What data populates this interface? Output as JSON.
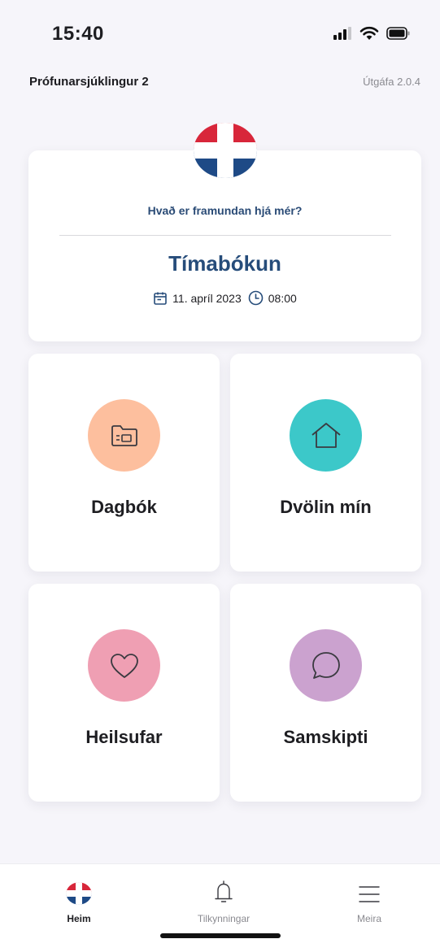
{
  "status_bar": {
    "time": "15:40"
  },
  "header": {
    "patient_name": "Prófunarsjúklingur 2",
    "version": "Útgáfa 2.0.4"
  },
  "hero": {
    "question": "Hvað er framundan hjá mér?",
    "title": "Tímabókun",
    "date": "11. apríl 2023",
    "time": "08:00"
  },
  "tiles": [
    {
      "label": "Dagbók",
      "icon": "folder-icon",
      "color": "#fdbf9e"
    },
    {
      "label": "Dvölin mín",
      "icon": "home-icon",
      "color": "#3cc8c9"
    },
    {
      "label": "Heilsufar",
      "icon": "heart-icon",
      "color": "#ef9fb3"
    },
    {
      "label": "Samskipti",
      "icon": "chat-bubble-icon",
      "color": "#cba2cf"
    }
  ],
  "bottom_nav": {
    "items": [
      {
        "label": "Heim",
        "icon": "logo-icon",
        "active": true
      },
      {
        "label": "Tilkynningar",
        "icon": "bell-icon",
        "active": false
      },
      {
        "label": "Meira",
        "icon": "menu-icon",
        "active": false
      }
    ]
  },
  "colors": {
    "brand_blue": "#264c7a",
    "brand_red": "#d8263a",
    "background": "#f6f5fa"
  }
}
